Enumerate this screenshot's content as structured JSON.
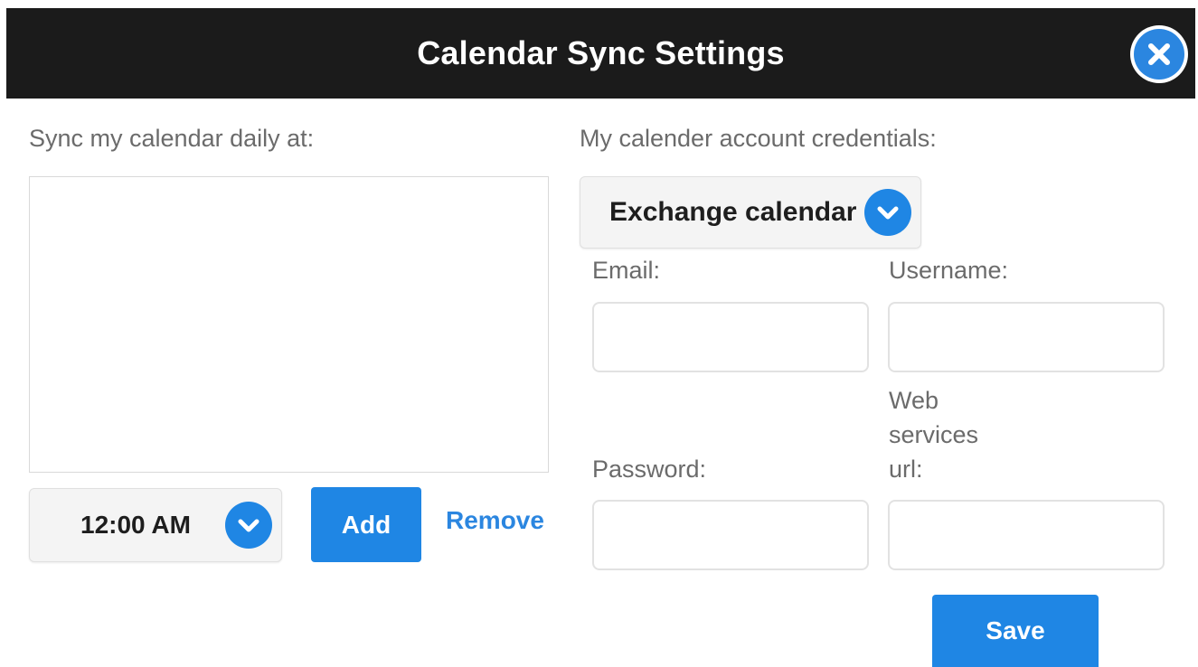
{
  "dialog": {
    "title": "Calendar Sync Settings",
    "close_icon": "close-circle-icon",
    "accent_color": "#1f86e4",
    "titlebar_color": "#1b1b1b"
  },
  "schedule": {
    "label": "Sync my calendar daily at:",
    "times": [],
    "time_select_value": "12:00 AM",
    "add_label": "Add",
    "remove_label": "Remove"
  },
  "credentials": {
    "label": "My calender account credentials:",
    "calendar_type_value": "Exchange calendar",
    "email_label": "Email:",
    "email_value": "",
    "username_label": "Username:",
    "username_value": "",
    "password_label": "Password:",
    "password_value": "",
    "url_label_line1": "Web",
    "url_label_line2": "services",
    "url_label_line3": "url:",
    "url_value": "",
    "save_label": "Save"
  }
}
